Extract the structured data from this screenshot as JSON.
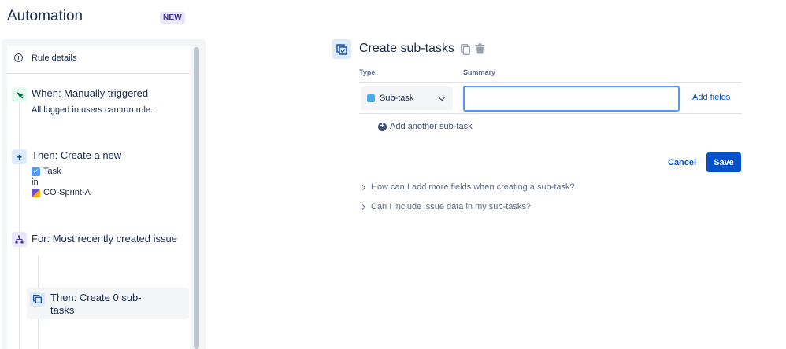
{
  "header": {
    "title": "Automation",
    "badge": "NEW"
  },
  "sidebar": {
    "rule_details": "Rule details",
    "trigger": {
      "title": "When: Manually triggered",
      "subtitle": "All logged in users can run rule."
    },
    "action": {
      "title": "Then: Create a new",
      "issue_type": "Task",
      "in_label": "in",
      "project": "CO-Sprint-A"
    },
    "branch": {
      "title": "For: Most recently created issue"
    },
    "sub_action": {
      "title": "Then: Create 0 sub-tasks"
    }
  },
  "panel": {
    "title": "Create sub-tasks",
    "columns": {
      "type": "Type",
      "summary": "Summary"
    },
    "row": {
      "type_value": "Sub-task",
      "summary_value": "",
      "summary_placeholder": ""
    },
    "add_fields": "Add fields",
    "add_another": "Add another sub-task",
    "cancel": "Cancel",
    "save": "Save",
    "faq": [
      "How can I add more fields when creating a sub-task?",
      "Can I include issue data in my sub-tasks?"
    ]
  },
  "colors": {
    "primary": "#0052cc",
    "focus_border": "#4c9aff",
    "text": "#172b4d",
    "subtle": "#5e6c84"
  }
}
